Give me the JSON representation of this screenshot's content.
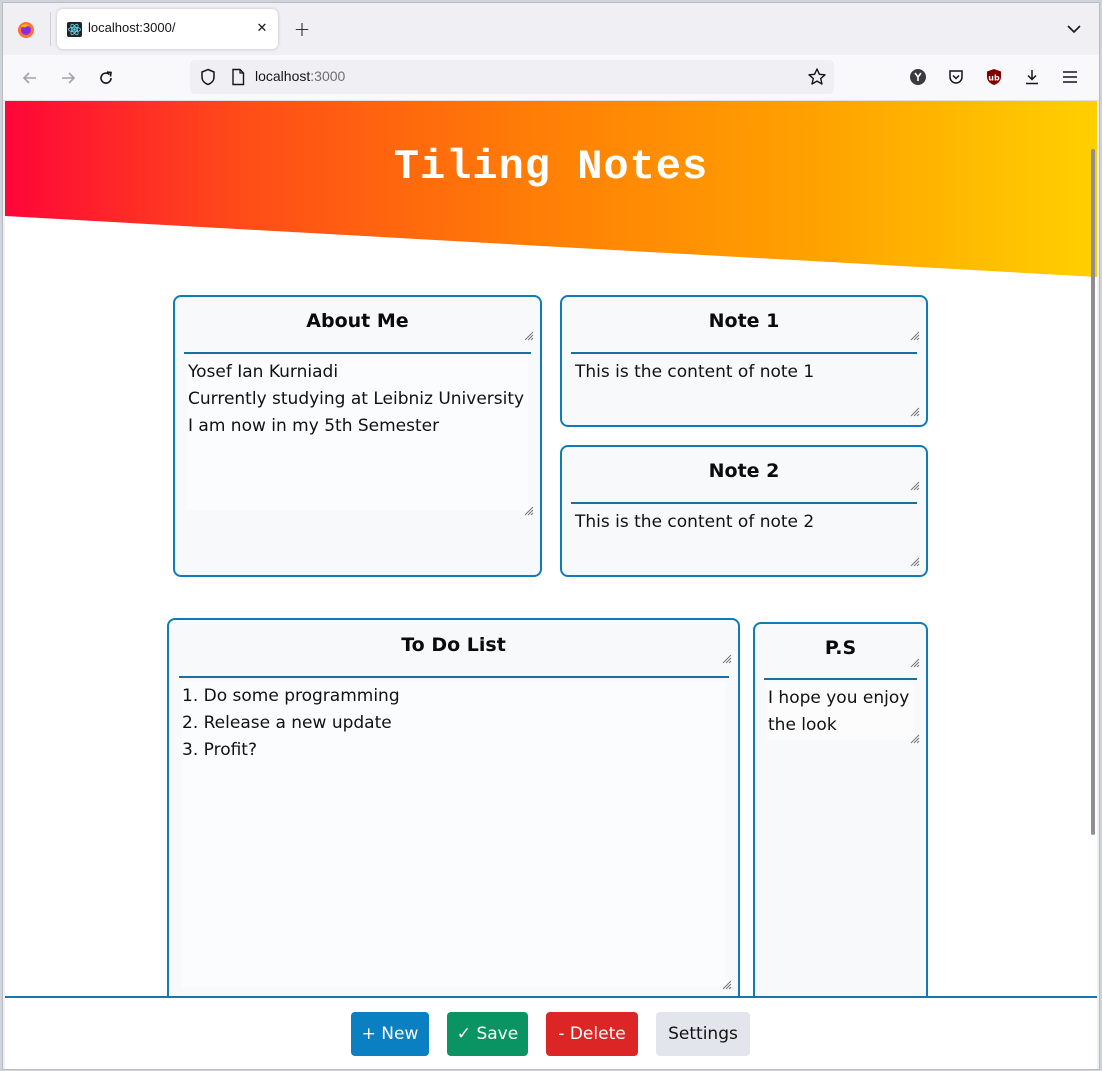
{
  "browser": {
    "tab": {
      "title": "localhost:3000/",
      "favicon": "react-icon"
    },
    "url": {
      "host": "localhost",
      "port": ":3000"
    }
  },
  "page": {
    "title": "Tiling Notes",
    "colors": {
      "accent": "#0f7cb8",
      "gradient_start": "#ff0538",
      "gradient_end": "#ffd000"
    }
  },
  "notes": {
    "about": {
      "title": "About Me",
      "content": "Yosef Ian Kurniadi\nCurrently studying at Leibniz University\nI am now in my 5th Semester"
    },
    "note1": {
      "title": "Note 1",
      "content": "This is the content of note 1"
    },
    "note2": {
      "title": "Note 2",
      "content": "This is the content of note 2"
    },
    "todo": {
      "title": "To Do List",
      "content": "1. Do some programming\n2. Release a new update\n3. Profit?"
    },
    "ps": {
      "title": "P.S",
      "content": "I hope you enjoy\nthe look"
    }
  },
  "toolbar": {
    "new_label": "+ New",
    "save_label": "✓ Save",
    "delete_label": "- Delete",
    "settings_label": "Settings",
    "colors": {
      "new": "#0a7fc1",
      "save": "#0a9464",
      "delete": "#dc2626",
      "settings": "#e2e6ec"
    }
  }
}
